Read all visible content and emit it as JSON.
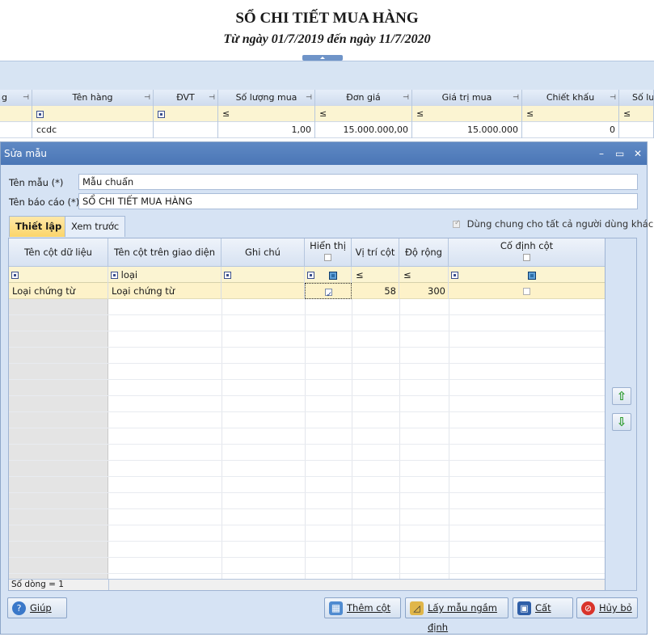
{
  "report": {
    "title": "SỔ CHI TIẾT MUA HÀNG",
    "subtitle": "Từ ngày 01/7/2019 đến ngày 11/7/2020"
  },
  "background_grid": {
    "columns": [
      "g",
      "Tên hàng",
      "ĐVT",
      "Số lượng mua",
      "Đơn giá",
      "Giá trị mua",
      "Chiết khấu",
      "Số lư"
    ],
    "filter_ops": [
      "≤",
      "≤",
      "≤",
      "≤",
      "≤"
    ],
    "row": {
      "ten_hang": "ccdc",
      "so_luong": "1,00",
      "don_gia": "15.000.000,00",
      "gia_tri": "15.000.000",
      "chiet_khau": "0"
    }
  },
  "dialog": {
    "title": "Sửa mẫu",
    "ten_mau_label": "Tên mẫu (*)",
    "ten_mau_value": "Mẫu chuẩn",
    "ten_bao_cao_label": "Tên báo cáo (*)",
    "ten_bao_cao_value": "SỔ CHI TIẾT MUA HÀNG",
    "tabs": [
      {
        "label": "Thiết lập",
        "active": true
      },
      {
        "label": "Xem trước",
        "active": false
      }
    ],
    "share_label": "Dùng chung cho tất cả người dùng khác",
    "share_checked": true,
    "grid": {
      "columns": [
        "Tên cột dữ liệu",
        "Tên cột trên giao diện",
        "Ghi chú",
        "Hiển thị",
        "Vị trí cột",
        "Độ rộng",
        "Cố định cột"
      ],
      "filter": {
        "ten_cot_giao_dien": "loại",
        "op_vi_tri": "≤",
        "op_do_rong": "≤"
      },
      "rows": [
        {
          "ten_cot_du_lieu": "Loại chứng từ",
          "ten_cot_giao_dien": "Loại chứng từ",
          "ghi_chu": "",
          "hien_thi": true,
          "vi_tri": "58",
          "do_rong": "300",
          "co_dinh": false
        }
      ],
      "footer": "Số dòng = 1"
    },
    "buttons": {
      "help": "Giúp",
      "add_column": "Thêm cột",
      "default_template": "Lấy mẫu ngầm định",
      "save": "Cất",
      "cancel": "Hủy bỏ"
    }
  },
  "colors": {
    "accent": "#4a76b6",
    "filter_row": "#fbf4d2",
    "selected_row": "#fdf2c9",
    "arrow": "#2b9a2b"
  }
}
